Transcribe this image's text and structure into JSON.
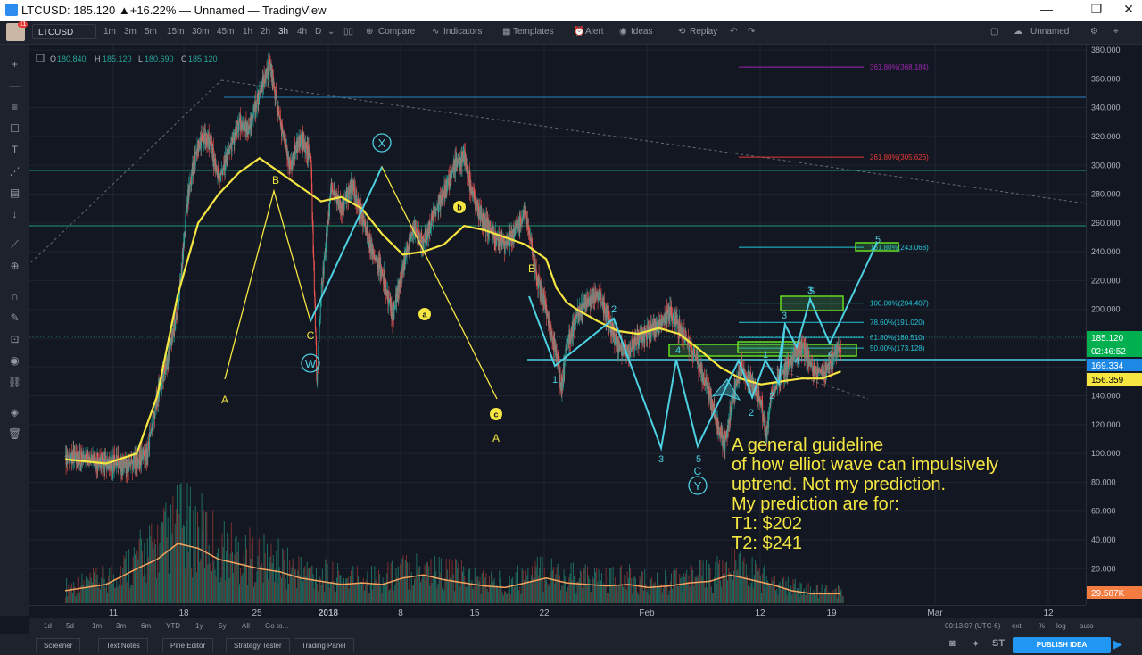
{
  "window": {
    "title": "LTCUSD: 185.120 ▲+16.22% — Unnamed — TradingView",
    "btn_min": "—",
    "btn_max": "❐",
    "btn_close": "✕"
  },
  "toolbar": {
    "badge": "11",
    "symbol": "LTCUSD",
    "intervals": [
      "1m",
      "3m",
      "5m",
      "15m",
      "30m",
      "45m",
      "1h",
      "2h",
      "3h",
      "4h",
      "D"
    ],
    "active_interval": "3h",
    "compare": "Compare",
    "indicators": "Indicators",
    "templates": "Templates",
    "alert": "Alert",
    "ideas": "Ideas",
    "replay": "Replay",
    "layout_name": "Unnamed"
  },
  "legend": {
    "o_label": "O",
    "o": "180.840",
    "h_label": "H",
    "h": "185.120",
    "l_label": "L",
    "l": "180.690",
    "c_label": "C",
    "c": "185.120"
  },
  "price_scale": {
    "ticks": [
      "380.000",
      "360.000",
      "340.000",
      "320.000",
      "300.000",
      "280.000",
      "260.000",
      "240.000",
      "220.000",
      "200.000",
      "180.000",
      "160.000",
      "140.000",
      "120.000",
      "100.000",
      "80.000",
      "60.000",
      "40.000",
      "20.000"
    ],
    "tags": [
      {
        "text": "185.120",
        "bg": "#00b050",
        "fg": "#ffffff"
      },
      {
        "text": "02:46:52",
        "bg": "#00b050",
        "fg": "#ffffff"
      },
      {
        "text": "169.334",
        "bg": "#1e88e5",
        "fg": "#ffffff"
      },
      {
        "text": "156.359",
        "bg": "#f5e642",
        "fg": "#000000"
      },
      {
        "text": "29.587K",
        "bg": "#f57c40",
        "fg": "#ffffff"
      }
    ]
  },
  "time_scale": {
    "labels": [
      "11",
      "18",
      "25",
      "2018",
      "8",
      "15",
      "22",
      "Feb",
      "12",
      "19",
      "Mar",
      "12"
    ]
  },
  "fib_levels": [
    {
      "text": "361.80%(368.184)",
      "color": "#9c27b0"
    },
    {
      "text": "261.80%(305.626)",
      "color": "#e53935"
    },
    {
      "text": "161.80%(243.068)",
      "color": "#26c6da"
    },
    {
      "text": "100.00%(204.407)",
      "color": "#26c6da"
    },
    {
      "text": "78.60%(191.020)",
      "color": "#26c6da"
    },
    {
      "text": "61.80%(180.510)",
      "color": "#26c6da"
    },
    {
      "text": "50.00%(173.128)",
      "color": "#26c6da"
    }
  ],
  "wave_labels": {
    "A1": "A",
    "B1": "B",
    "C1": "C",
    "W": "W",
    "X": "X",
    "a": "a",
    "b": "b",
    "c": "c",
    "A2": "A",
    "B2": "B",
    "C2": "C",
    "Y": "Y",
    "i1": "1",
    "i2": "2",
    "i3": "3",
    "i4": "4",
    "i5": "5",
    "p1": "1",
    "p2": "2",
    "p2b": "2",
    "p3": "3",
    "p3b": "3",
    "p4": "4",
    "p4b": "4",
    "p5": "5",
    "p5top": "5"
  },
  "annotation": {
    "lines": [
      "A general guideline",
      "of how elliot wave can impulsively",
      "uptrend. Not my prediction.",
      "My prediction are for:",
      "T1: $202",
      "T2: $241"
    ]
  },
  "range_bar": {
    "buttons": [
      "1d",
      "5d",
      "1m",
      "3m",
      "6m",
      "YTD",
      "1y",
      "5y",
      "All",
      "Go to..."
    ],
    "clock": "00:13:07 (UTC-6)",
    "opts": [
      "ext",
      "%",
      "log",
      "auto"
    ]
  },
  "bottom_tabs": [
    "Screener",
    "Text Notes",
    "Pine Editor",
    "Strategy Tester",
    "Trading Panel"
  ],
  "publish": "PUBLISH IDEA",
  "colors": {
    "background": "#131722",
    "up": "#26a69a",
    "ma": "#f5e642",
    "wave": "#4dd0e1",
    "label": "#f5e642",
    "volume_ma": "#f4a460"
  },
  "chart_data": {
    "type": "candlestick",
    "symbol": "LTCUSD",
    "ylim": [
      0,
      390
    ],
    "yticks": [
      20,
      40,
      60,
      80,
      100,
      120,
      140,
      160,
      180,
      200,
      220,
      240,
      260,
      280,
      300,
      320,
      340,
      360,
      380
    ],
    "price_path": [
      [
        0,
        98
      ],
      [
        3,
        95
      ],
      [
        6,
        92
      ],
      [
        8,
        100
      ],
      [
        9,
        140
      ],
      [
        10,
        165
      ],
      [
        11,
        200
      ],
      [
        12,
        280
      ],
      [
        13,
        315
      ],
      [
        14,
        320
      ],
      [
        15,
        290
      ],
      [
        16,
        310
      ],
      [
        17,
        330
      ],
      [
        18,
        325
      ],
      [
        19,
        350
      ],
      [
        20,
        370
      ],
      [
        21,
        330
      ],
      [
        22,
        300
      ],
      [
        23,
        320
      ],
      [
        24,
        305
      ],
      [
        24.6,
        150
      ],
      [
        25,
        210
      ],
      [
        26,
        285
      ],
      [
        27,
        270
      ],
      [
        28,
        287
      ],
      [
        29,
        265
      ],
      [
        30,
        240
      ],
      [
        31,
        225
      ],
      [
        32,
        195
      ],
      [
        33,
        230
      ],
      [
        34,
        255
      ],
      [
        35,
        245
      ],
      [
        36,
        265
      ],
      [
        37,
        280
      ],
      [
        38,
        300
      ],
      [
        39,
        305
      ],
      [
        40,
        275
      ],
      [
        41,
        260
      ],
      [
        42,
        250
      ],
      [
        43,
        245
      ],
      [
        44,
        255
      ],
      [
        45,
        268
      ],
      [
        46,
        225
      ],
      [
        47,
        200
      ],
      [
        48,
        168
      ],
      [
        48.5,
        145
      ],
      [
        49,
        175
      ],
      [
        50,
        195
      ],
      [
        51,
        205
      ],
      [
        52,
        212
      ],
      [
        53,
        195
      ],
      [
        54,
        175
      ],
      [
        55,
        170
      ],
      [
        56,
        180
      ],
      [
        57,
        185
      ],
      [
        58,
        190
      ],
      [
        59,
        198
      ],
      [
        60,
        188
      ],
      [
        61,
        175
      ],
      [
        62,
        160
      ],
      [
        63,
        140
      ],
      [
        64,
        112
      ],
      [
        64.5,
        108
      ],
      [
        65,
        130
      ],
      [
        66,
        160
      ],
      [
        67,
        150
      ],
      [
        68,
        135
      ],
      [
        68.5,
        110
      ],
      [
        69,
        140
      ],
      [
        70,
        155
      ],
      [
        71,
        165
      ],
      [
        72,
        175
      ],
      [
        73,
        160
      ],
      [
        74,
        155
      ],
      [
        75,
        165
      ],
      [
        75.8,
        175
      ]
    ],
    "moving_average": [
      [
        0,
        96
      ],
      [
        4,
        93
      ],
      [
        7,
        100
      ],
      [
        9,
        140
      ],
      [
        11,
        210
      ],
      [
        13,
        260
      ],
      [
        15,
        280
      ],
      [
        17,
        295
      ],
      [
        19,
        305
      ],
      [
        21,
        295
      ],
      [
        23,
        285
      ],
      [
        25,
        275
      ],
      [
        27,
        278
      ],
      [
        29,
        270
      ],
      [
        31,
        252
      ],
      [
        33,
        238
      ],
      [
        35,
        240
      ],
      [
        37,
        245
      ],
      [
        39,
        258
      ],
      [
        41,
        255
      ],
      [
        43,
        250
      ],
      [
        45,
        245
      ],
      [
        47,
        235
      ],
      [
        48,
        215
      ],
      [
        49,
        205
      ],
      [
        50,
        200
      ],
      [
        52,
        192
      ],
      [
        54,
        185
      ],
      [
        56,
        183
      ],
      [
        58,
        187
      ],
      [
        60,
        183
      ],
      [
        62,
        172
      ],
      [
        64,
        160
      ],
      [
        66,
        152
      ],
      [
        68,
        148
      ],
      [
        70,
        150
      ],
      [
        72,
        152
      ],
      [
        74,
        152
      ],
      [
        75.8,
        157
      ]
    ],
    "volume_ma": [
      [
        0,
        8
      ],
      [
        4,
        12
      ],
      [
        7,
        22
      ],
      [
        9,
        28
      ],
      [
        11,
        38
      ],
      [
        13,
        35
      ],
      [
        15,
        28
      ],
      [
        17,
        25
      ],
      [
        19,
        22
      ],
      [
        21,
        20
      ],
      [
        23,
        16
      ],
      [
        25,
        14
      ],
      [
        27,
        12
      ],
      [
        29,
        13
      ],
      [
        31,
        12
      ],
      [
        33,
        16
      ],
      [
        35,
        18
      ],
      [
        37,
        15
      ],
      [
        39,
        13
      ],
      [
        41,
        11
      ],
      [
        43,
        10
      ],
      [
        45,
        13
      ],
      [
        47,
        16
      ],
      [
        49,
        13
      ],
      [
        51,
        12
      ],
      [
        53,
        11
      ],
      [
        55,
        12
      ],
      [
        57,
        10
      ],
      [
        59,
        11
      ],
      [
        61,
        13
      ],
      [
        63,
        14
      ],
      [
        65,
        18
      ],
      [
        67,
        15
      ],
      [
        69,
        12
      ],
      [
        71,
        8
      ],
      [
        73,
        6
      ],
      [
        75.8,
        6
      ]
    ],
    "elliott_primary": [
      [
        24.6,
        150
      ],
      [
        28,
        287
      ],
      [
        32,
        195
      ],
      [
        38,
        303
      ],
      [
        48.5,
        145
      ]
    ],
    "elliott_abc_second": [
      [
        38,
        303
      ],
      [
        42,
        270
      ],
      [
        46,
        225
      ],
      [
        48.5,
        145
      ]
    ],
    "elliott_impulse": [
      [
        53.5,
        173
      ],
      [
        55,
        178
      ],
      [
        57.5,
        195
      ],
      [
        60,
        182
      ],
      [
        63,
        118
      ],
      [
        64.5,
        172
      ],
      [
        66.5,
        110
      ],
      [
        69.5,
        178
      ],
      [
        71,
        155
      ],
      [
        72.5,
        170
      ],
      [
        73.5,
        160
      ],
      [
        75,
        180
      ]
    ],
    "elliott_projection": [
      [
        75,
        178
      ],
      [
        77,
        193
      ],
      [
        78,
        180
      ],
      [
        80,
        205
      ],
      [
        82,
        180
      ],
      [
        85,
        243
      ]
    ],
    "x_axis": {
      "min": 0,
      "max": 100,
      "labels": [
        "11",
        "18",
        "25",
        "2018",
        "8",
        "15",
        "22",
        "Feb",
        "12",
        "19",
        "Mar",
        "12"
      ]
    },
    "volume_ylim": [
      0,
      60
    ]
  }
}
